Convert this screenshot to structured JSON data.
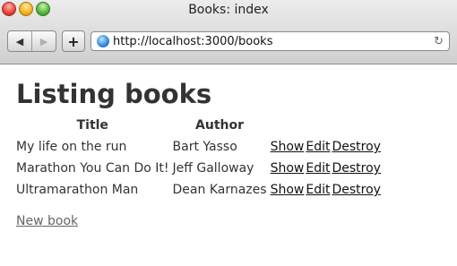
{
  "window": {
    "title": "Books: index"
  },
  "toolbar": {
    "url": "http://localhost:3000/books"
  },
  "page": {
    "heading": "Listing books",
    "columns": [
      "Title",
      "Author"
    ],
    "rows": [
      {
        "title": "My life on the run",
        "author": "Bart Yasso"
      },
      {
        "title": "Marathon You Can Do It!",
        "author": "Jeff Galloway"
      },
      {
        "title": "Ultramarathon Man",
        "author": "Dean Karnazes"
      }
    ],
    "actions": {
      "show": "Show",
      "edit": "Edit",
      "destroy": "Destroy"
    },
    "new_link": "New book"
  }
}
